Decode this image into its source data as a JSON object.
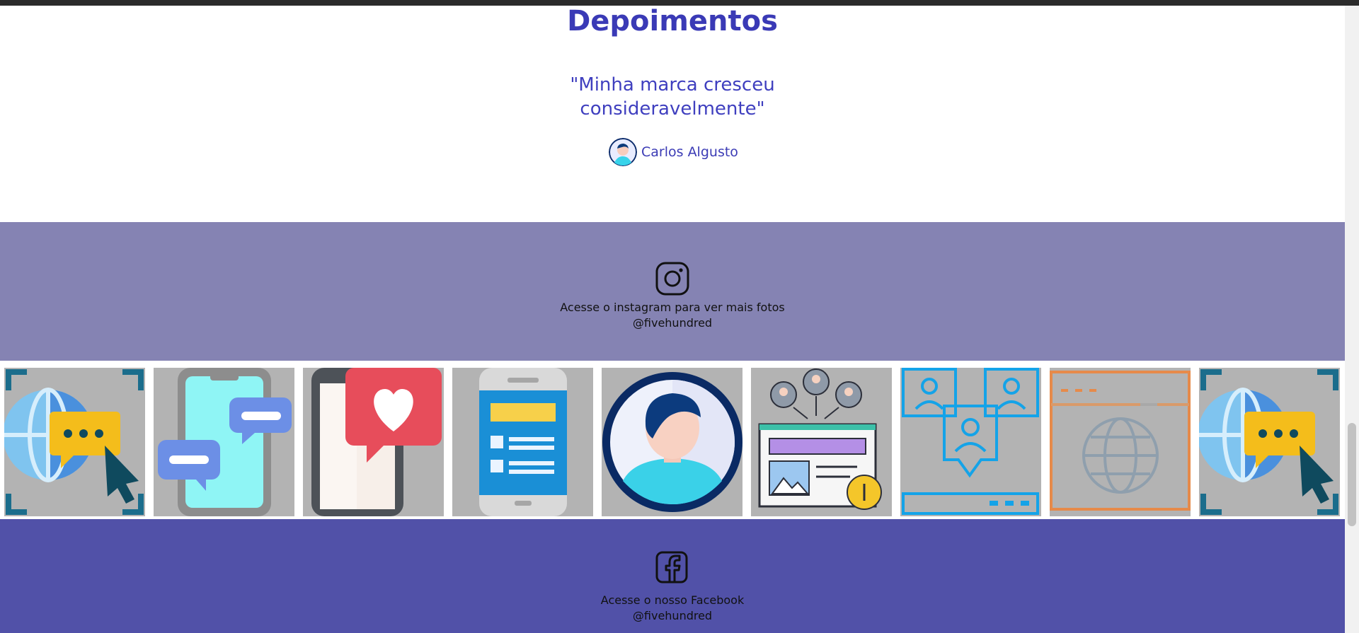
{
  "testimonials": {
    "title": "Depoimentos",
    "quote": "\"Minha marca cresceu consideravelmente\"",
    "author": "Carlos Algusto"
  },
  "instagram": {
    "icon": "instagram-icon",
    "text": "Acesse o instagram para ver mais fotos",
    "handle": "@fivehundred"
  },
  "gallery": {
    "tiles": [
      {
        "icon": "globe-chat-icon"
      },
      {
        "icon": "phone-chat-icon"
      },
      {
        "icon": "phone-heart-icon"
      },
      {
        "icon": "phone-list-icon"
      },
      {
        "icon": "user-avatar-icon"
      },
      {
        "icon": "network-content-icon"
      },
      {
        "icon": "users-network-icon"
      },
      {
        "icon": "browser-globe-icon"
      },
      {
        "icon": "globe-chat-icon"
      }
    ]
  },
  "facebook": {
    "icon": "facebook-icon",
    "text": "Acesse o nosso Facebook",
    "handle": "@fivehundred"
  },
  "colors": {
    "title": "#3a3ab6",
    "instagram_bg": "#8583b3",
    "facebook_bg": "#5151a8",
    "tile_bg": "#b3b3b3"
  }
}
